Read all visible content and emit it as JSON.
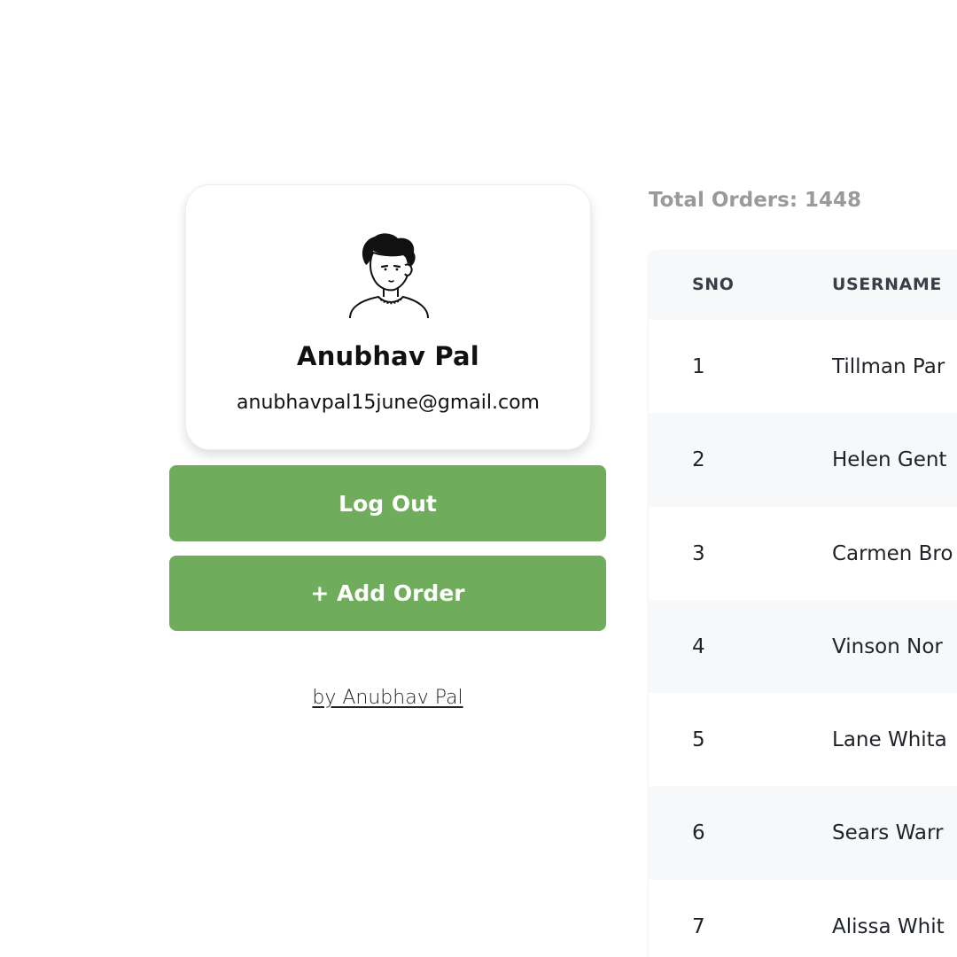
{
  "profile": {
    "name": "Anubhav Pal",
    "email": "anubhavpal15june@gmail.com",
    "avatar_icon": "cartoon-boy-avatar-icon"
  },
  "actions": {
    "logout_label": "Log Out",
    "add_order_label": "+ Add Order",
    "button_color": "#6fad5c"
  },
  "footer": {
    "credit": "by Anubhav Pal"
  },
  "orders": {
    "total_label": "Total Orders: 1448",
    "columns": [
      "SNO",
      "USERNAME"
    ],
    "rows": [
      {
        "sno": "1",
        "username": "Tillman Par"
      },
      {
        "sno": "2",
        "username": "Helen Gent"
      },
      {
        "sno": "3",
        "username": "Carmen Bro"
      },
      {
        "sno": "4",
        "username": "Vinson Nor"
      },
      {
        "sno": "5",
        "username": "Lane Whita"
      },
      {
        "sno": "6",
        "username": "Sears Warr"
      },
      {
        "sno": "7",
        "username": "Alissa Whit"
      }
    ]
  }
}
